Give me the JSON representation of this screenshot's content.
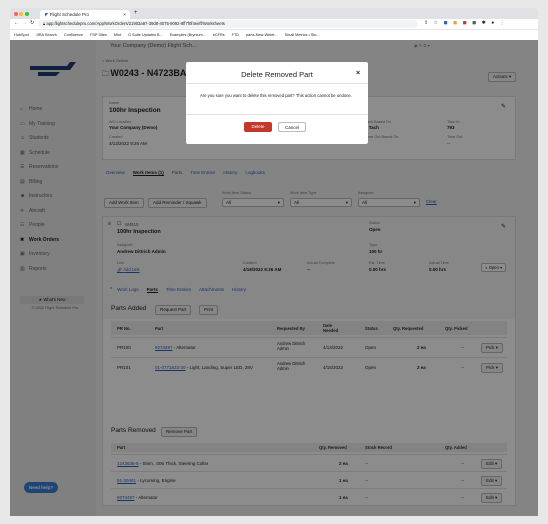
{
  "browser": {
    "tab_title": "Flight Schedule Pro",
    "url": "app.flightschedulepro.com/App/WorkOrders/21903a97-39d8-4075-9092-8ff7f0f4eeff/Worksheets",
    "bookmarks": [
      "HubSpot",
      "JIRA Search",
      "Confluence",
      "FSP Sites",
      "Mint",
      "G Suite Updates B...",
      "Examples (Brynium...",
      "eCFRs",
      "FTD",
      "parts-New-Webfr...",
      "Small Metrics • Sto..."
    ]
  },
  "header": {
    "school_name": "Your Company (Demo) Flight Sch...",
    "work_orders_link": "< Work Orders",
    "page_title": "W0243 - N4723BAD",
    "actions_label": "Actions ▾"
  },
  "sidebar": {
    "items": [
      {
        "label": "Home"
      },
      {
        "label": "My Training"
      },
      {
        "label": "Students"
      },
      {
        "label": "Schedule"
      },
      {
        "label": "Reservations"
      },
      {
        "label": "Billing"
      },
      {
        "label": "Instructors"
      },
      {
        "label": "Aircraft"
      },
      {
        "label": "People"
      },
      {
        "label": "Work Orders"
      },
      {
        "label": "Inventory"
      },
      {
        "label": "Reports"
      }
    ],
    "whats_new": "★ What's New",
    "copyright": "© 2022 Flight Schedule Pro",
    "need_help": "Need help?"
  },
  "summary": {
    "name_label": "Name",
    "name_value": "100hr Inspection",
    "location_label": "WO Location",
    "location_value": "Your Company (Demo)",
    "created_label": "Created",
    "created_value": "4/13/2022 9:26 AM",
    "actual_start_label": "Actual Start",
    "actual_start_value": "--",
    "actual_complete_label": "Actual Complete",
    "actual_complete_value": "--",
    "tach_label": "Tach Based On",
    "tach_value": "1 Tach",
    "tach_out_label": "Time Out Based On",
    "tach_out_value": "--",
    "time_in_label": "Time In",
    "time_in_value": "793",
    "time_out_label": "Time Out",
    "time_out_value": "--"
  },
  "main_tabs": [
    "Overview",
    "Work Items (1)",
    "Parts",
    "Time Entries",
    "History",
    "Logbooks"
  ],
  "filters": {
    "add_work_item": "Add Work Item",
    "add_reminder": "Add Reminder / Squawk",
    "status_label": "Work Item Status",
    "status_value": "All",
    "type_label": "Work Item Type",
    "type_value": "All",
    "assignee_label": "Assignee",
    "assignee_value": "All",
    "clear": "Clear"
  },
  "work_item": {
    "id": "W4610",
    "title": "100hr Inspection",
    "status_label": "Status",
    "status_value": "Open",
    "assignee_label": "Assignee",
    "assignee_value": "Andrew Dittrich Admin",
    "type_label": "Type",
    "type_value": "100 hr",
    "link_label": "Link",
    "link_value": "Add Link",
    "created_label": "Created",
    "created_value": "4/18/2022 9:26 AM",
    "actual_complete_label": "Actual Complete",
    "actual_complete_value": "--",
    "est_time_label": "Est. Time",
    "est_time_value": "0.00 hrs",
    "actual_time_label": "Actual Time",
    "actual_time_value": "0.00 hrs",
    "open_button": "Open",
    "sub_tabs": [
      "Work Logs",
      "Parts",
      "Time Entries",
      "Attachments",
      "History"
    ]
  },
  "parts_added": {
    "title": "Parts Added",
    "request_btn": "Request Part",
    "print_btn": "Print",
    "columns": [
      "PR No.",
      "Part",
      "Requested By",
      "Date Needed",
      "Status",
      "Qty. Requested",
      "Qty. Picked"
    ],
    "rows": [
      {
        "pr": "PR100",
        "part_link": "9273497",
        "part_desc": " - Alternator",
        "requested_by": "Andrew Dittrich Admin",
        "date": "4/13/2022",
        "status": "Open",
        "qty_req": "2 ea",
        "qty_picked": "--",
        "action": "Pick"
      },
      {
        "pr": "PR101",
        "part_link": "01-0771833-20",
        "part_desc": " - Light, Landing, Super LED, 28V",
        "requested_by": "Andrew Dittrich Admin",
        "date": "4/15/2022",
        "status": "Open",
        "qty_req": "2 ea",
        "qty_picked": "--",
        "action": "Pick"
      }
    ]
  },
  "parts_removed": {
    "title": "Parts Removed",
    "remove_btn": "Remove Part",
    "columns": [
      "Part",
      "Qty. Removed",
      "Stock Record",
      "Qty. Added"
    ],
    "rows": [
      {
        "part_link": "1243636-5",
        "part_desc": " - Shim, .006 Thick, Steering Collar",
        "qty_removed": "2 ea",
        "stock": "--",
        "qty_added": "--",
        "action": "Edit"
      },
      {
        "part_link": "61-30461",
        "part_desc": " - Lycoming, Engine",
        "qty_removed": "1 ea",
        "stock": "--",
        "qty_added": "--",
        "action": "Edit"
      },
      {
        "part_link": "9273497",
        "part_desc": " - Alternator",
        "qty_removed": "1 ea",
        "stock": "--",
        "qty_added": "--",
        "action": "Edit"
      }
    ]
  },
  "modal": {
    "title": "Delete Removed Part",
    "close": "×",
    "message": "Are you sure you want to delete this removed part? This action cannot be undone.",
    "delete_btn": "Delete",
    "cancel_btn": "Cancel"
  },
  "colors": {
    "accent": "#2a62b8",
    "danger": "#c0392b",
    "logo_blue": "#1c3c6e",
    "help_blue": "#3a7fd5",
    "open_green": "#4caf50"
  }
}
